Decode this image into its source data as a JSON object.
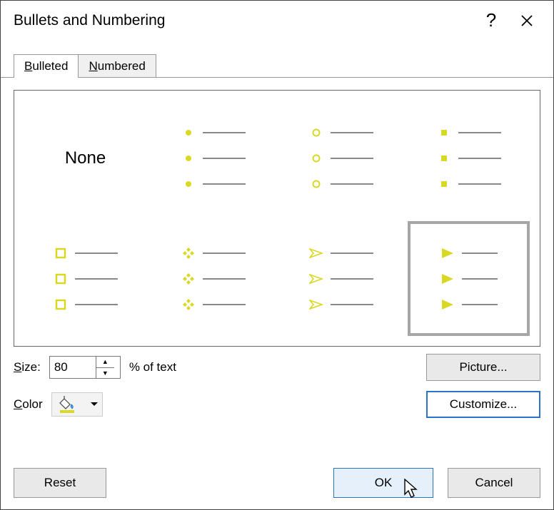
{
  "title": "Bullets and Numbering",
  "titlebar": {
    "help": "?",
    "close": "✕"
  },
  "tabs": {
    "bulleted": "Bulleted",
    "numbered": "Numbered",
    "active": "bulleted"
  },
  "grid": {
    "none_label": "None",
    "selected_index": 7,
    "styles": [
      "none",
      "filled-circle",
      "hollow-circle",
      "filled-square",
      "hollow-square",
      "diamond-cluster",
      "arrowhead",
      "filled-triangle"
    ]
  },
  "size": {
    "label": "Size:",
    "label_ul": "S",
    "value": "80",
    "suffix": "% of text"
  },
  "color": {
    "label": "Color",
    "label_ul": "C",
    "value": "#d8d825"
  },
  "buttons": {
    "picture": "Picture...",
    "picture_ul": "P",
    "customize": "Customize...",
    "customize_ul": "u",
    "reset": "Reset",
    "reset_ul": "R",
    "ok": "OK",
    "cancel": "Cancel"
  }
}
